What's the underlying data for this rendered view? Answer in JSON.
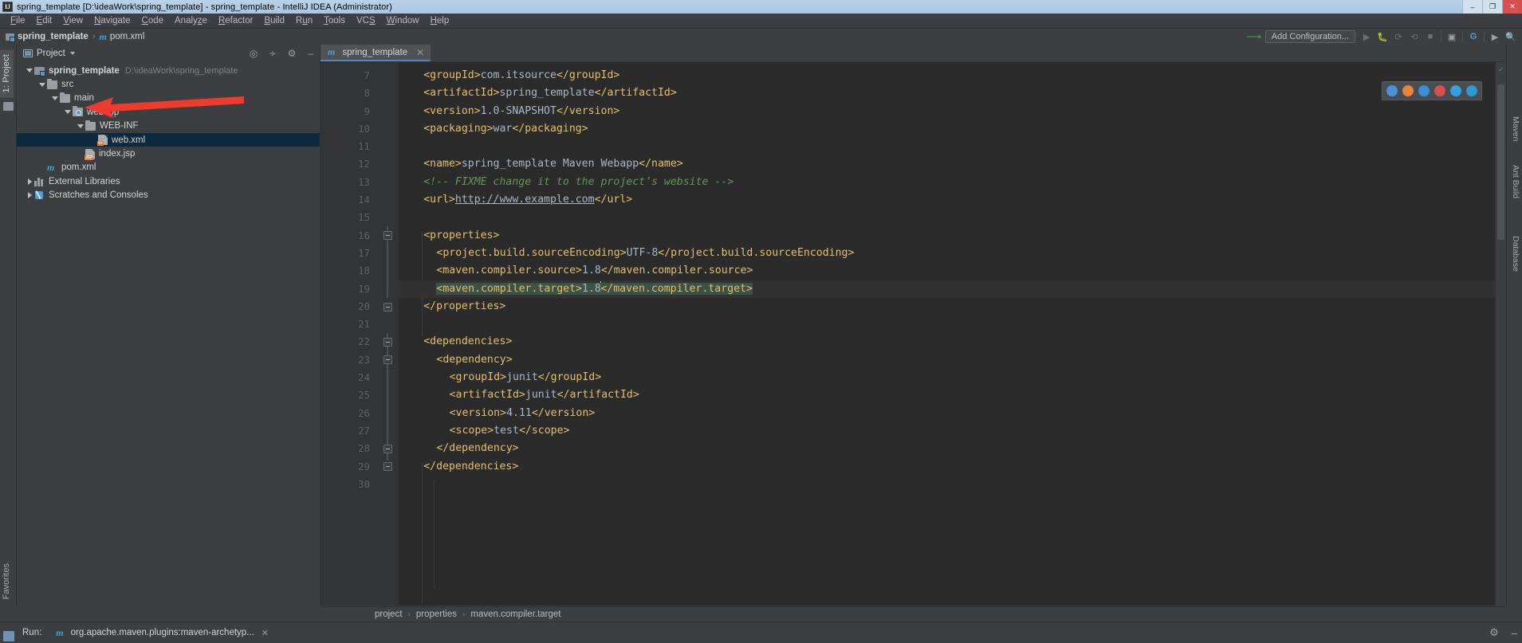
{
  "window": {
    "title": "spring_template [D:\\ideaWork\\spring_template] - spring_template - IntelliJ IDEA (Administrator)",
    "app_icon_text": "IJ",
    "minimize": "–",
    "maximize": "❐",
    "close": "✕"
  },
  "menu": [
    {
      "label": "File",
      "mnemonic": "F"
    },
    {
      "label": "Edit",
      "mnemonic": "E"
    },
    {
      "label": "View",
      "mnemonic": "V"
    },
    {
      "label": "Navigate",
      "mnemonic": "N"
    },
    {
      "label": "Code",
      "mnemonic": "C"
    },
    {
      "label": "Analyze",
      "mnemonic": "z"
    },
    {
      "label": "Refactor",
      "mnemonic": "R"
    },
    {
      "label": "Build",
      "mnemonic": "B"
    },
    {
      "label": "Run",
      "mnemonic": "u"
    },
    {
      "label": "Tools",
      "mnemonic": "T"
    },
    {
      "label": "VCS",
      "mnemonic": "S"
    },
    {
      "label": "Window",
      "mnemonic": "W"
    },
    {
      "label": "Help",
      "mnemonic": "H"
    }
  ],
  "navbar": {
    "crumbs": [
      "spring_template",
      "pom.xml"
    ],
    "separator": "›",
    "run_configuration": "Add Configuration...",
    "icons": [
      "run-icon",
      "debug-icon",
      "run-coverage-icon",
      "profile-icon",
      "stop-icon",
      "build-icon",
      "translate-icon",
      "terminal-icon",
      "search-everywhere-icon"
    ]
  },
  "left_strip": {
    "project_tab": "1: Project",
    "favorites_tab": "Favorites"
  },
  "right_strip": {
    "tabs": [
      "Maven",
      "Ant Build",
      "Database"
    ]
  },
  "project_panel": {
    "title": "Project",
    "header_icons": [
      "target-icon",
      "collapse-all-icon",
      "settings-gear-icon",
      "hide-icon"
    ],
    "tree": [
      {
        "label": "spring_template",
        "path": "D:\\ideaWork\\spring_template",
        "depth": 0,
        "icon": "module-icon",
        "expanded": true,
        "bold": true,
        "selected": false
      },
      {
        "label": "src",
        "path": "",
        "depth": 1,
        "icon": "folder-icon",
        "expanded": true,
        "bold": false,
        "selected": false
      },
      {
        "label": "main",
        "path": "",
        "depth": 2,
        "icon": "folder-icon",
        "expanded": true,
        "bold": false,
        "selected": false
      },
      {
        "label": "webapp",
        "path": "",
        "depth": 3,
        "icon": "web-folder-icon",
        "expanded": true,
        "bold": false,
        "selected": false
      },
      {
        "label": "WEB-INF",
        "path": "",
        "depth": 4,
        "icon": "folder-icon",
        "expanded": true,
        "bold": false,
        "selected": false
      },
      {
        "label": "web.xml",
        "path": "",
        "depth": 5,
        "icon": "xml-file-icon",
        "expanded": null,
        "bold": false,
        "selected": true
      },
      {
        "label": "index.jsp",
        "path": "",
        "depth": 4,
        "icon": "jsp-file-icon",
        "expanded": null,
        "bold": false,
        "selected": false
      },
      {
        "label": "pom.xml",
        "path": "",
        "depth": 1,
        "icon": "maven-file-icon",
        "expanded": null,
        "bold": false,
        "selected": false
      },
      {
        "label": "External Libraries",
        "path": "",
        "depth": 0,
        "icon": "library-icon",
        "expanded": false,
        "bold": false,
        "selected": false
      },
      {
        "label": "Scratches and Consoles",
        "path": "",
        "depth": 0,
        "icon": "scratch-icon",
        "expanded": false,
        "bold": false,
        "selected": false
      }
    ]
  },
  "editor": {
    "tab": {
      "label": "spring_template",
      "icon": "maven-icon",
      "close": "✕"
    },
    "first_line_number": 7,
    "lines": [
      {
        "n": 7,
        "indent": 2,
        "fold": null,
        "html": "<span class='tag'>&lt;groupId&gt;</span><span class='txt'>com.itsource</span><span class='tag'>&lt;/groupId&gt;</span>"
      },
      {
        "n": 8,
        "indent": 2,
        "fold": null,
        "html": "<span class='tag'>&lt;artifactId&gt;</span><span class='txt'>spring_template</span><span class='tag'>&lt;/artifactId&gt;</span>"
      },
      {
        "n": 9,
        "indent": 2,
        "fold": null,
        "html": "<span class='tag'>&lt;version&gt;</span><span class='txt'>1.0-SNAPSHOT</span><span class='tag'>&lt;/version&gt;</span>"
      },
      {
        "n": 10,
        "indent": 2,
        "fold": null,
        "html": "<span class='tag'>&lt;packaging&gt;</span><span class='txt'>war</span><span class='tag'>&lt;/packaging&gt;</span>"
      },
      {
        "n": 11,
        "indent": 0,
        "fold": null,
        "html": ""
      },
      {
        "n": 12,
        "indent": 2,
        "fold": null,
        "html": "<span class='tag'>&lt;name&gt;</span><span class='txt'>spring_template Maven Webapp</span><span class='tag'>&lt;/name&gt;</span>"
      },
      {
        "n": 13,
        "indent": 2,
        "fold": null,
        "html": "<span class='cmt'>&lt;!-- FIXME change it to the project&#8217;s website --&gt;</span>"
      },
      {
        "n": 14,
        "indent": 2,
        "fold": null,
        "html": "<span class='tag'>&lt;url&gt;</span><span class='link'>http://www.example.com</span><span class='tag'>&lt;/url&gt;</span>"
      },
      {
        "n": 15,
        "indent": 0,
        "fold": null,
        "html": ""
      },
      {
        "n": 16,
        "indent": 2,
        "fold": "open",
        "html": "<span class='tag'>&lt;properties&gt;</span>"
      },
      {
        "n": 17,
        "indent": 4,
        "fold": null,
        "html": "<span class='tag'>&lt;project.build.sourceEncoding&gt;</span><span class='txt'>UTF-8</span><span class='tag'>&lt;/project.build.sourceEncoding&gt;</span>"
      },
      {
        "n": 18,
        "indent": 4,
        "fold": null,
        "html": "<span class='tag'>&lt;maven.compiler.source&gt;</span><span class='txt'>1.8</span><span class='tag'>&lt;/maven.compiler.source&gt;</span>"
      },
      {
        "n": 19,
        "indent": 4,
        "fold": null,
        "caret": true,
        "html": "<span class='sel'><span class='tag'>&lt;maven.compiler.target&gt;</span><span class='txt'>1.8</span></span><span class='caret'></span><span class='sel'><span class='tag'>&lt;/maven.compiler.target&gt;</span></span>"
      },
      {
        "n": 20,
        "indent": 2,
        "fold": "close",
        "html": "<span class='tag'>&lt;/properties&gt;</span>"
      },
      {
        "n": 21,
        "indent": 0,
        "fold": null,
        "html": ""
      },
      {
        "n": 22,
        "indent": 2,
        "fold": "open",
        "html": "<span class='tag'>&lt;dependencies&gt;</span>"
      },
      {
        "n": 23,
        "indent": 4,
        "fold": "open",
        "html": "<span class='tag'>&lt;dependency&gt;</span>"
      },
      {
        "n": 24,
        "indent": 6,
        "fold": null,
        "html": "<span class='tag'>&lt;groupId&gt;</span><span class='txt'>junit</span><span class='tag'>&lt;/groupId&gt;</span>"
      },
      {
        "n": 25,
        "indent": 6,
        "fold": null,
        "html": "<span class='tag'>&lt;artifactId&gt;</span><span class='txt'>junit</span><span class='tag'>&lt;/artifactId&gt;</span>"
      },
      {
        "n": 26,
        "indent": 6,
        "fold": null,
        "html": "<span class='tag'>&lt;version&gt;</span><span class='txt'>4.11</span><span class='tag'>&lt;/version&gt;</span>"
      },
      {
        "n": 27,
        "indent": 6,
        "fold": null,
        "html": "<span class='tag'>&lt;scope&gt;</span><span class='txt'>test</span><span class='tag'>&lt;/scope&gt;</span>"
      },
      {
        "n": 28,
        "indent": 4,
        "fold": "close",
        "html": "<span class='tag'>&lt;/dependency&gt;</span>"
      },
      {
        "n": 29,
        "indent": 2,
        "fold": "close",
        "html": "<span class='tag'>&lt;/dependencies&gt;</span>"
      },
      {
        "n": 30,
        "indent": 0,
        "fold": null,
        "html": ""
      }
    ],
    "breadcrumb": [
      "project",
      "properties",
      "maven.compiler.target"
    ],
    "breadcrumb_separator": "›",
    "inspection_status": "ok-check-icon"
  },
  "browser_popup": {
    "icons": [
      "chrome-icon",
      "firefox-icon",
      "edge-legacy-icon",
      "opera-icon",
      "edge-icon",
      "ie-icon"
    ],
    "colors": [
      "#4a90d9",
      "#e8833a",
      "#3a8fd9",
      "#d94f4f",
      "#3aa0d9",
      "#2e9ad0"
    ]
  },
  "status_bar": {
    "run_label": "Run:",
    "run_tab": "org.apache.maven.plugins:maven-archetyp...",
    "run_tab_close": "✕",
    "icons": [
      "settings-gear-icon",
      "hide-icon"
    ]
  },
  "colors": {
    "accent": "#4a88c7",
    "selection": "#3b5244",
    "tree_selection": "#0d293e",
    "tag": "#e8bf6a",
    "text": "#a9b7c6",
    "comment": "#629755",
    "background": "#2b2b2b",
    "chrome": "#3c3f41",
    "arrow_annotation": "#ef3b2d"
  }
}
